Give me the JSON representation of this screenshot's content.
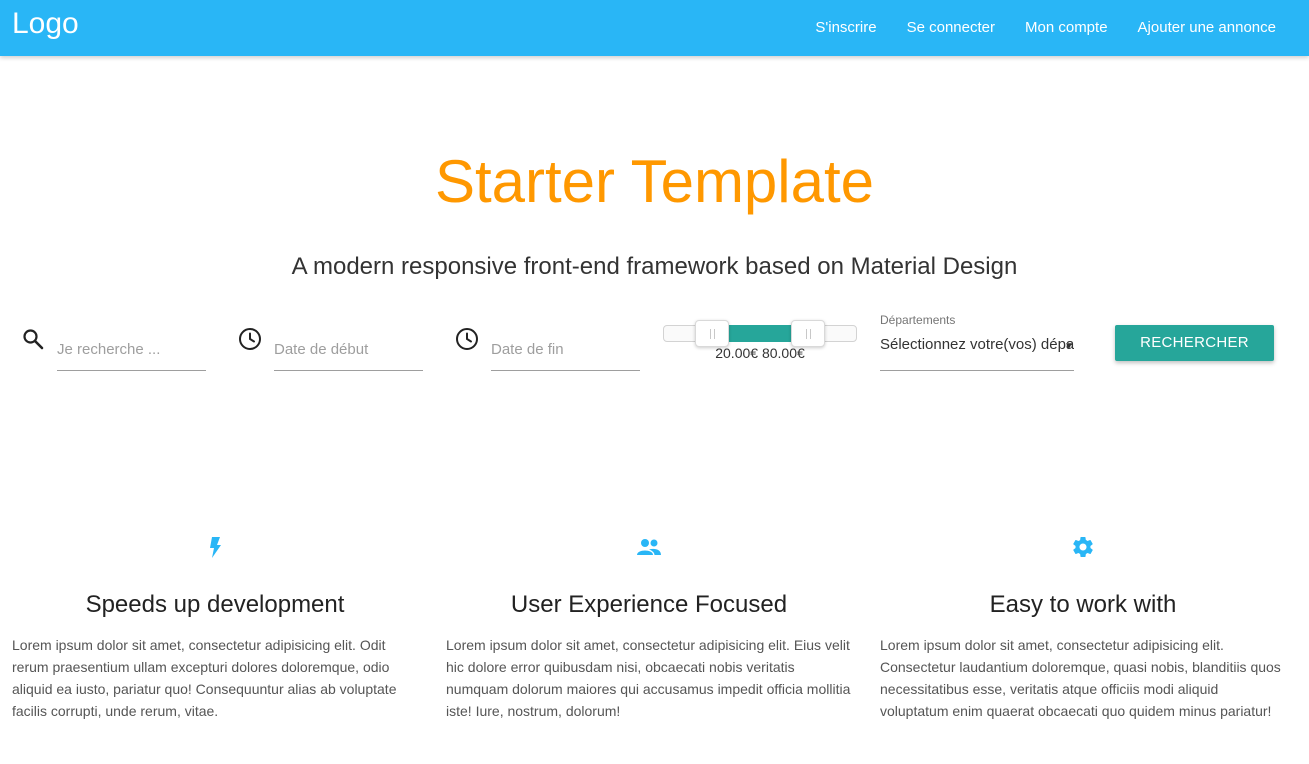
{
  "navbar": {
    "logo": "Logo",
    "links": [
      "S'inscrire",
      "Se connecter",
      "Mon compte",
      "Ajouter une annonce"
    ],
    "color": "#29b6f6"
  },
  "hero": {
    "title": "Starter Template",
    "subtitle": "A modern responsive front-end framework based on Material Design",
    "title_color": "#ff9800"
  },
  "search": {
    "keyword_placeholder": "Je recherche ...",
    "start_date_placeholder": "Date de début",
    "end_date_placeholder": "Date de fin",
    "price_range": {
      "min": 20.0,
      "max": 80.0,
      "label": "20.00€ 80.00€"
    },
    "departments_label": "Départements",
    "departments_value": "Sélectionnez votre(vos) dépa",
    "submit_label": "RECHERCHER",
    "accent": "#26a69a"
  },
  "features": [
    {
      "icon": "flash-icon",
      "title": "Speeds up development",
      "text": "Lorem ipsum dolor sit amet, consectetur adipisicing elit. Odit rerum praesentium ullam excepturi dolores doloremque, odio aliquid ea iusto, pariatur quo! Consequuntur alias ab voluptate facilis corrupti, unde rerum, vitae."
    },
    {
      "icon": "group-icon",
      "title": "User Experience Focused",
      "text": "Lorem ipsum dolor sit amet, consectetur adipisicing elit. Eius velit hic dolore error quibusdam nisi, obcaecati nobis veritatis numquam dolorum maiores qui accusamus impedit officia mollitia iste! Iure, nostrum, dolorum!"
    },
    {
      "icon": "settings-icon",
      "title": "Easy to work with",
      "text": "Lorem ipsum dolor sit amet, consectetur adipisicing elit. Consectetur laudantium doloremque, quasi nobis, blanditiis quos necessitatibus esse, veritatis atque officiis modi aliquid voluptatum enim quaerat obcaecati quo quidem minus pariatur!"
    }
  ],
  "feature_icon_color": "#29b6f6"
}
